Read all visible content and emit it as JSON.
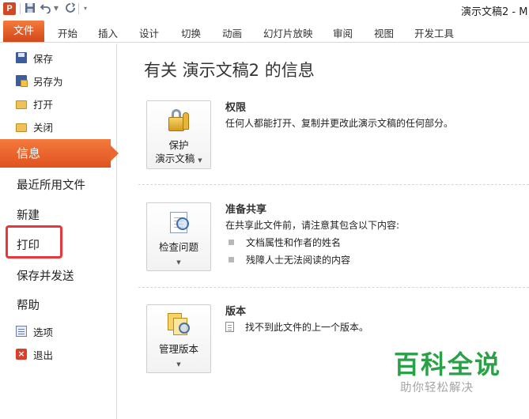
{
  "window": {
    "title": "演示文稿2 - M"
  },
  "quick_access": {
    "logo_letter": "P",
    "save_icon": "save-icon",
    "undo_icon": "undo-icon",
    "redo_icon": "redo-icon"
  },
  "ribbon": {
    "file_tab": "文件",
    "tabs": [
      "开始",
      "插入",
      "设计",
      "切换",
      "动画",
      "幻灯片放映",
      "审阅",
      "视图",
      "开发工具"
    ]
  },
  "sidebar": {
    "save": "保存",
    "save_as": "另存为",
    "open": "打开",
    "close": "关闭",
    "info": "信息",
    "recent": "最近所用文件",
    "new": "新建",
    "print": "打印",
    "save_send": "保存并发送",
    "help": "帮助",
    "options": "选项",
    "exit": "退出"
  },
  "main": {
    "title": "有关 演示文稿2 的信息",
    "permissions": {
      "button_line1": "保护",
      "button_line2": "演示文稿",
      "title": "权限",
      "desc": "任何人都能打开、复制并更改此演示文稿的任何部分。"
    },
    "prepare": {
      "button_label": "检查问题",
      "title": "准备共享",
      "desc": "在共享此文件前，请注意其包含以下内容:",
      "bullets": [
        "文档属性和作者的姓名",
        "残障人士无法阅读的内容"
      ]
    },
    "versions": {
      "button_label": "管理版本",
      "title": "版本",
      "desc": "找不到此文件的上一个版本。"
    }
  },
  "watermark": {
    "title": "百科全说",
    "subtitle": "助你轻松解决"
  }
}
